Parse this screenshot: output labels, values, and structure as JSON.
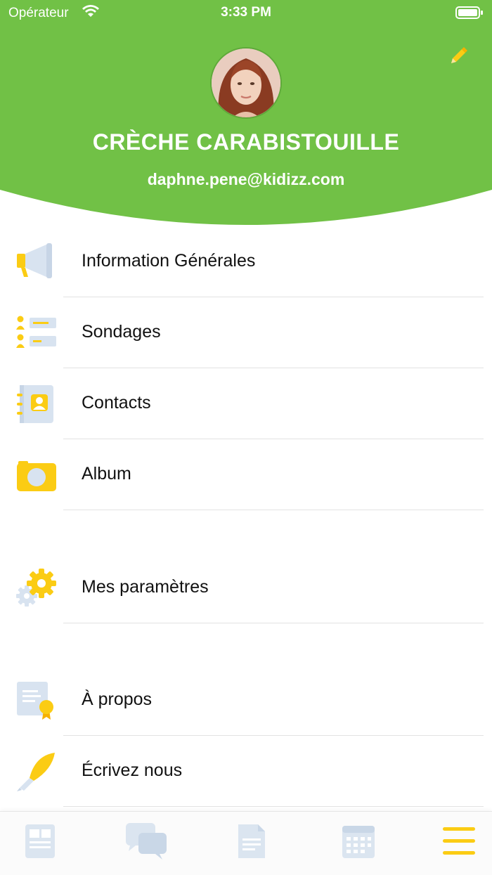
{
  "status_bar": {
    "carrier": "Opérateur",
    "time": "3:33 PM"
  },
  "profile": {
    "name": "CRÈCHE CARABISTOUILLE",
    "email": "daphne.pene@kidizz.com"
  },
  "menu": [
    {
      "label": "Information Générales",
      "icon": "megaphone-icon"
    },
    {
      "label": "Sondages",
      "icon": "survey-icon"
    },
    {
      "label": "Contacts",
      "icon": "contacts-book-icon"
    },
    {
      "label": "Album",
      "icon": "camera-icon"
    },
    {
      "label": "Mes paramètres",
      "icon": "gear-icon"
    },
    {
      "label": "À propos",
      "icon": "certificate-icon"
    },
    {
      "label": "Écrivez nous",
      "icon": "quill-pen-icon"
    }
  ],
  "tabs": [
    {
      "icon": "newsfeed-icon",
      "active": false
    },
    {
      "icon": "chat-bubbles-icon",
      "active": false
    },
    {
      "icon": "document-icon",
      "active": false
    },
    {
      "icon": "calendar-icon",
      "active": false
    },
    {
      "icon": "hamburger-menu-icon",
      "active": true
    }
  ],
  "colors": {
    "header_green": "#71c146",
    "accent_yellow": "#fbcc14",
    "icon_blue": "#d8e3f0",
    "tab_inactive": "#dbe5f0"
  }
}
